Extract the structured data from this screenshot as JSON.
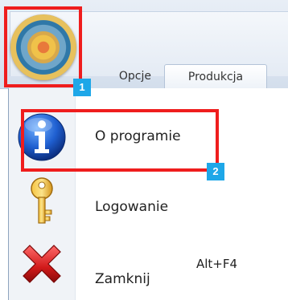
{
  "ribbon": {
    "tabs": [
      {
        "label": "Opcje",
        "selected": false
      },
      {
        "label": "Produkcja",
        "selected": true
      },
      {
        "label": "",
        "selected": false
      }
    ]
  },
  "menu": {
    "items": [
      {
        "label": "O programie",
        "shortcut": "",
        "icon": "info-icon"
      },
      {
        "label": "Logowanie",
        "shortcut": "",
        "icon": "key-icon"
      },
      {
        "label": "Zamknij",
        "shortcut": "Alt+F4",
        "icon": "close-icon"
      }
    ]
  },
  "annotations": [
    {
      "number": "1",
      "target": "app-orb-button",
      "color": "#ef1d1d"
    },
    {
      "number": "2",
      "target": "menu-item-o-programie",
      "color": "#ef1d1d"
    }
  ],
  "colors": {
    "highlight": "#ef1d1d",
    "badge": "#1ea7e8"
  }
}
